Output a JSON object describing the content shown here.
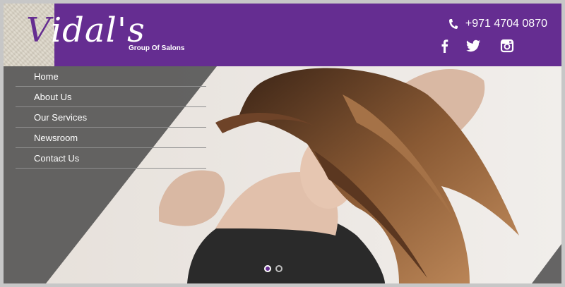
{
  "brand": {
    "logo_initial": "V",
    "logo_rest": "idal's",
    "tagline": "Group Of Salons"
  },
  "contact": {
    "phone": "+971 4704 0870"
  },
  "social": [
    "facebook-icon",
    "twitter-icon",
    "instagram-icon"
  ],
  "nav": {
    "items": [
      {
        "label": "Home"
      },
      {
        "label": "About Us"
      },
      {
        "label": "Our Services"
      },
      {
        "label": "Newsroom"
      },
      {
        "label": "Contact Us"
      }
    ]
  },
  "slider": {
    "slide_count": 2,
    "active_index": 0
  },
  "colors": {
    "brand_purple": "#652d91",
    "overlay_gray": "#464646"
  }
}
